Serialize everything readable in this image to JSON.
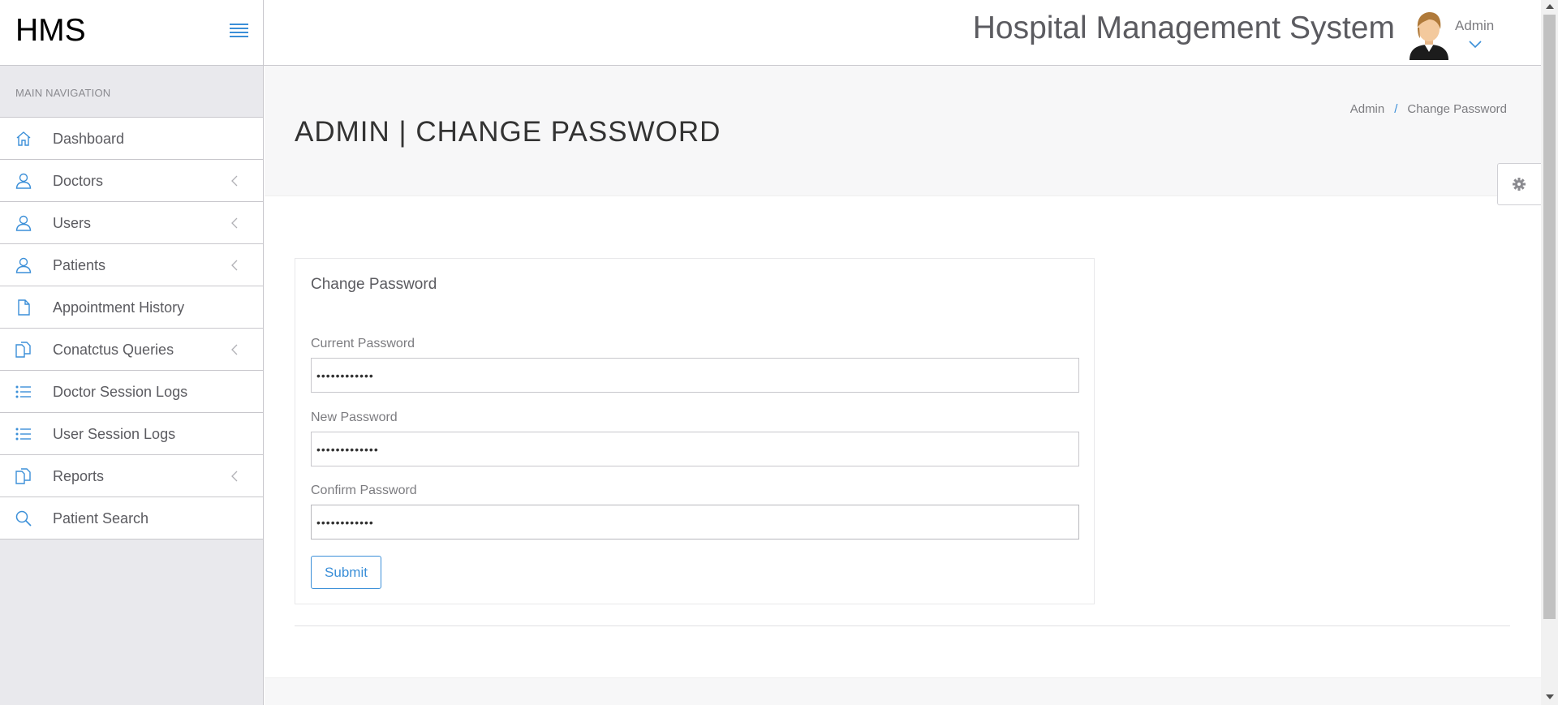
{
  "brand": {
    "logo_text": "HMS"
  },
  "header": {
    "app_title": "Hospital Management System",
    "user_name": "Admin"
  },
  "sidebar": {
    "heading": "MAIN NAVIGATION",
    "items": [
      {
        "label": "Dashboard",
        "icon": "home-icon",
        "has_submenu": false
      },
      {
        "label": "Doctors",
        "icon": "user-icon",
        "has_submenu": true
      },
      {
        "label": "Users",
        "icon": "user-icon",
        "has_submenu": true
      },
      {
        "label": "Patients",
        "icon": "user-icon",
        "has_submenu": true
      },
      {
        "label": "Appointment History",
        "icon": "file-icon",
        "has_submenu": false
      },
      {
        "label": "Conatctus Queries",
        "icon": "files-icon",
        "has_submenu": true
      },
      {
        "label": "Doctor Session Logs",
        "icon": "list-icon",
        "has_submenu": false
      },
      {
        "label": "User Session Logs",
        "icon": "list-icon",
        "has_submenu": false
      },
      {
        "label": "Reports",
        "icon": "files-icon",
        "has_submenu": true
      },
      {
        "label": "Patient Search",
        "icon": "search-icon",
        "has_submenu": false
      }
    ]
  },
  "page": {
    "title": "ADMIN | CHANGE PASSWORD",
    "breadcrumb": {
      "parent": "Admin",
      "separator": "/",
      "current": "Change Password"
    }
  },
  "form": {
    "panel_title": "Change Password",
    "current_password": {
      "label": "Current Password",
      "value": "••••••••••••"
    },
    "new_password": {
      "label": "New Password",
      "value": "•••••••••••••"
    },
    "confirm_password": {
      "label": "Confirm Password",
      "value": "••••••••••••"
    },
    "submit_label": "Submit"
  },
  "colors": {
    "accent": "#3b8fd8",
    "sidebar_bg": "#e9e9ed",
    "text": "#5b5b60",
    "border": "#c8c7cc"
  }
}
